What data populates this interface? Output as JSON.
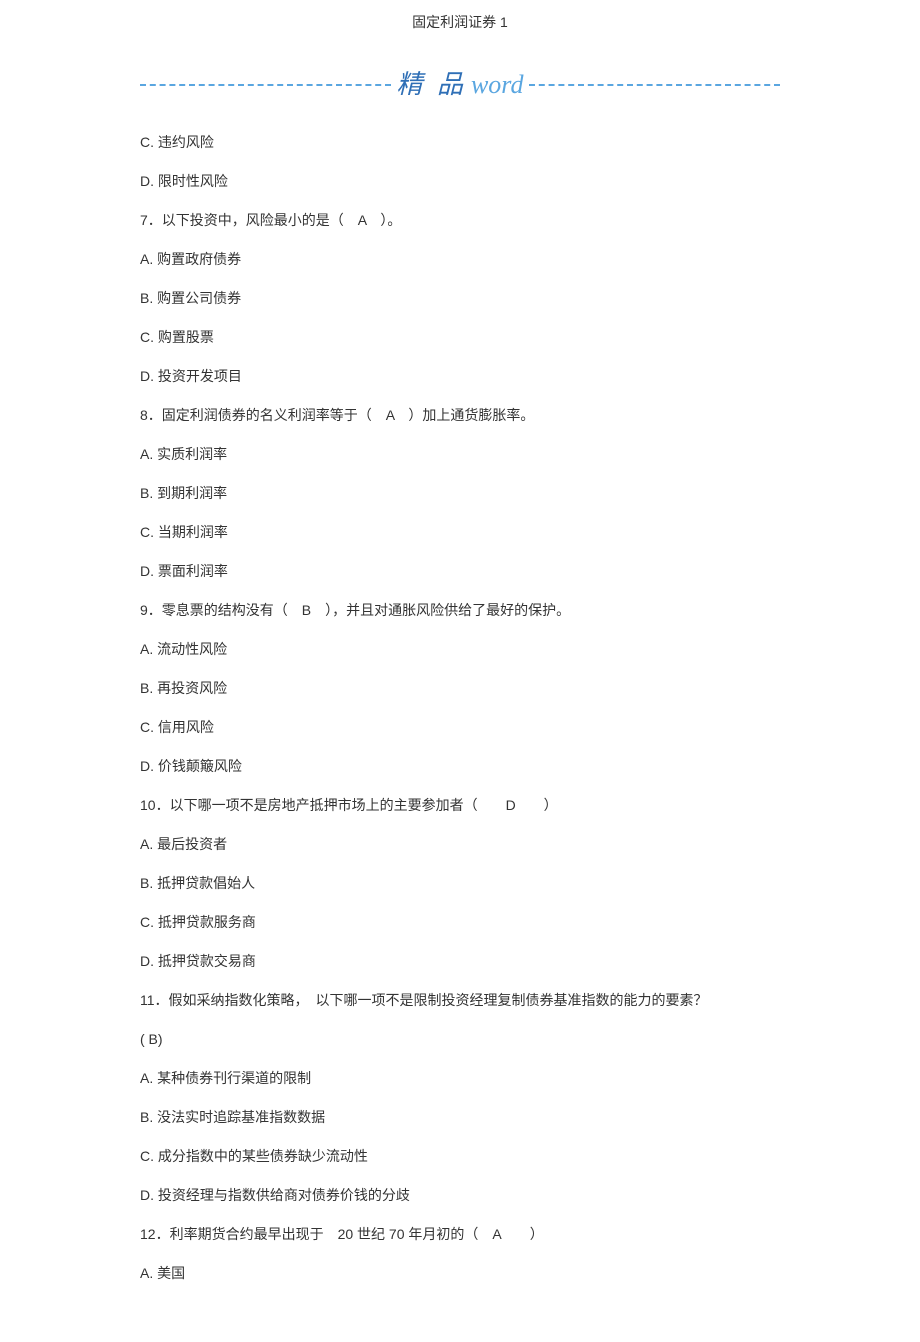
{
  "header": {
    "title": "固定利润证券 1"
  },
  "brand": {
    "cn": "精 品",
    "en": "word"
  },
  "lines": [
    "C. 违约风险",
    "D. 限时性风险",
    "7．以下投资中，风险最小的是（　A　）。",
    "A. 购置政府债券",
    "B. 购置公司债券",
    "C. 购置股票",
    "D. 投资开发项目",
    "8．固定利润债券的名义利润率等于（　A　）加上通货膨胀率。",
    "A. 实质利润率",
    "B. 到期利润率",
    "C. 当期利润率",
    "D. 票面利润率",
    "9．零息票的结构没有（　B　），并且对通胀风险供给了最好的保护。",
    "A. 流动性风险",
    "B. 再投资风险",
    "C. 信用风险",
    "D. 价钱颠簸风险",
    "10．以下哪一项不是房地产抵押市场上的主要参加者（　　D　　）",
    "A. 最后投资者",
    "B. 抵押贷款倡始人",
    "C. 抵押贷款服务商",
    "D. 抵押贷款交易商",
    "11．假如采纳指数化策略，　以下哪一项不是限制投资经理复制债券基准指数的能力的要素？",
    "( B)",
    "A. 某种债券刊行渠道的限制",
    "B. 没法实时追踪基准指数数据",
    "C. 成分指数中的某些债券缺少流动性",
    "D. 投资经理与指数供给商对债券价钱的分歧",
    "12．利率期货合约最早出现于　20 世纪 70 年月初的（ A  ）",
    "A. 美国"
  ]
}
